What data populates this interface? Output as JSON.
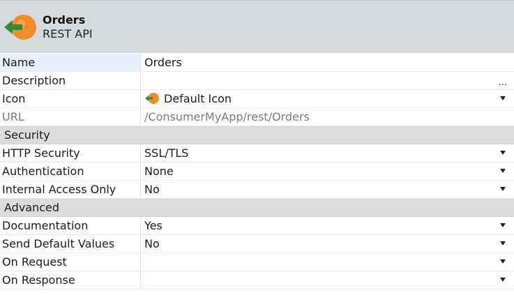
{
  "header": {
    "title": "Orders",
    "subtitle": "REST API",
    "icon": "orange-ball-green-arrow-icon"
  },
  "properties": {
    "name": {
      "label": "Name",
      "value": "Orders"
    },
    "description": {
      "label": "Description",
      "value": "",
      "ellipsis": "..."
    },
    "icon": {
      "label": "Icon",
      "value": "Default Icon"
    },
    "url": {
      "label": "URL",
      "value": "/ConsumerMyApp/rest/Orders"
    }
  },
  "security": {
    "title": "Security",
    "http_security": {
      "label": "HTTP Security",
      "value": "SSL/TLS"
    },
    "authentication": {
      "label": "Authentication",
      "value": "None"
    },
    "internal_access": {
      "label": "Internal Access Only",
      "value": "No"
    }
  },
  "advanced": {
    "title": "Advanced",
    "documentation": {
      "label": "Documentation",
      "value": "Yes"
    },
    "send_default_values": {
      "label": "Send Default Values",
      "value": "No"
    },
    "on_request": {
      "label": "On Request",
      "value": ""
    },
    "on_response": {
      "label": "On Response",
      "value": ""
    }
  },
  "colors": {
    "header_bg": "#d7dadc",
    "section_bg": "#dcdcdc",
    "icon_orange": "#f28c28",
    "icon_green": "#2e8b3a",
    "selected_bg": "#e8f0fb"
  }
}
